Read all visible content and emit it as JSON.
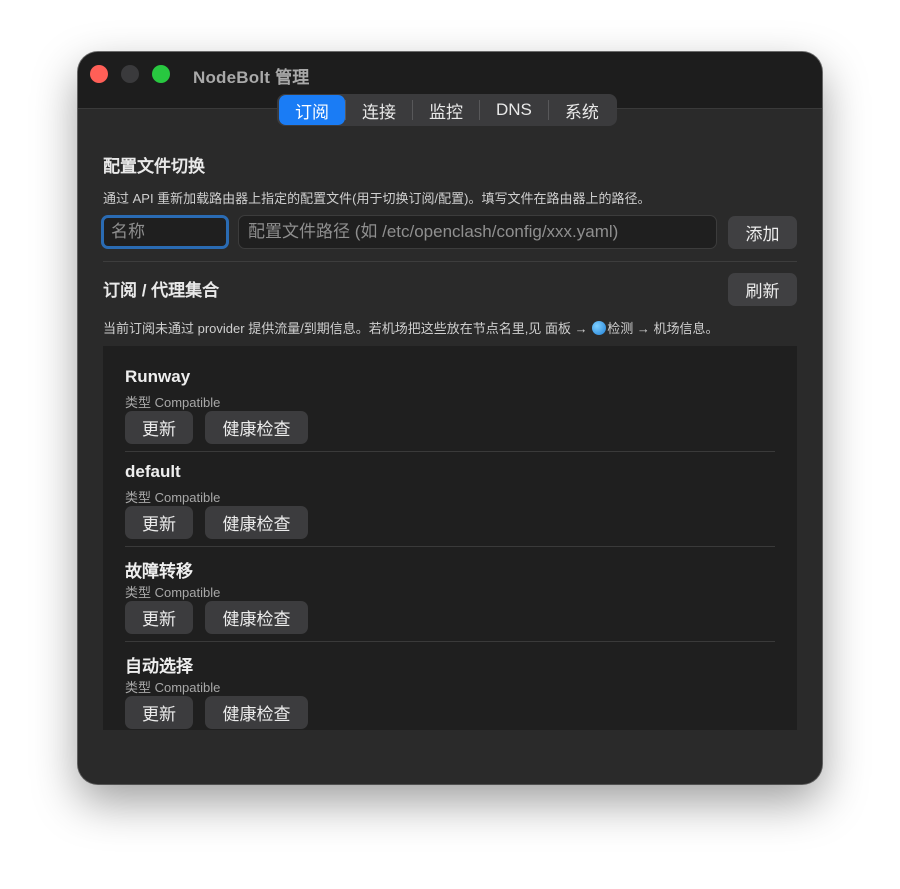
{
  "window": {
    "title": "NodeBolt 管理"
  },
  "tabs": [
    {
      "label": "订阅",
      "active": true
    },
    {
      "label": "连接"
    },
    {
      "label": "监控"
    },
    {
      "label": "DNS"
    },
    {
      "label": "系统"
    }
  ],
  "profile": {
    "heading": "配置文件切换",
    "description": "通过 API 重新加载路由器上指定的配置文件(用于切换订阅/配置)。填写文件在路由器上的路径。",
    "name_placeholder": "名称",
    "path_placeholder": "配置文件路径 (如 /etc/openclash/config/xxx.yaml)",
    "add_label": "添加"
  },
  "providers": {
    "heading": "订阅 / 代理集合",
    "refresh_label": "刷新",
    "note_before_icon": "当前订阅未通过 provider 提供流量/到期信息。若机场把这些放在节点名里,见 面板 → ",
    "note_icon": "globe-icon",
    "note_after_icon": "检测 → 机场信息。",
    "items": [
      {
        "name": "Runway",
        "type": "类型 Compatible",
        "update_label": "更新",
        "health_label": "健康检查"
      },
      {
        "name": "default",
        "type": "类型 Compatible",
        "update_label": "更新",
        "health_label": "健康检查"
      },
      {
        "name": "故障转移",
        "type": "类型 Compatible",
        "update_label": "更新",
        "health_label": "健康检查"
      },
      {
        "name": "自动选择",
        "type": "类型 Compatible",
        "update_label": "更新",
        "health_label": "健康检查"
      }
    ]
  },
  "colors": {
    "accent": "#1a7cf5",
    "close": "#ff5f57",
    "zoom": "#28c840",
    "focus_ring": "#2a6bb3"
  }
}
